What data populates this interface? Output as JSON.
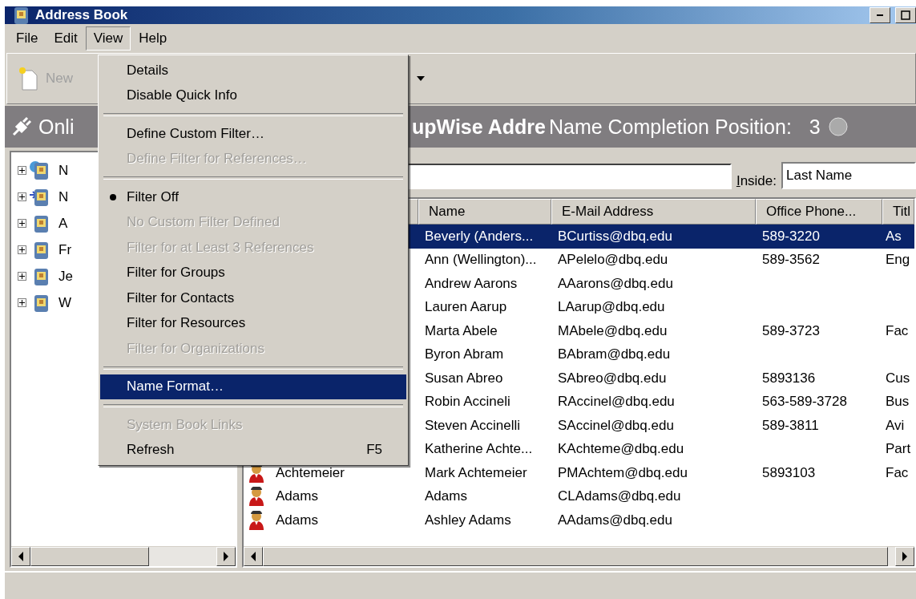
{
  "window": {
    "title": "Address Book"
  },
  "menubar": [
    {
      "label": "File",
      "selected": false
    },
    {
      "label": "Edit",
      "selected": false
    },
    {
      "label": "View",
      "selected": true
    },
    {
      "label": "Help",
      "selected": false
    }
  ],
  "toolbar": {
    "new_button": {
      "label": "New",
      "disabled": true
    }
  },
  "header": {
    "left_text": "Onli",
    "right_text": "upWise Addre",
    "position_label": "Name Completion Position:",
    "position_value": "3"
  },
  "tree": [
    {
      "label": "N",
      "kind": "globe-book",
      "expanded": false
    },
    {
      "label": "N",
      "kind": "link-book",
      "expanded": false
    },
    {
      "label": "A",
      "kind": "book",
      "expanded": false
    },
    {
      "label": "Fr",
      "kind": "book",
      "expanded": false
    },
    {
      "label": "Je",
      "kind": "book",
      "expanded": false
    },
    {
      "label": "W",
      "kind": "book",
      "expanded": false
    }
  ],
  "search": {
    "inside_label": "Inside:",
    "inside_value": "Last Name"
  },
  "table": {
    "columns": [
      "Name",
      "E-Mail Address",
      "Office Phone...",
      "Titl"
    ],
    "rows": [
      {
        "selected": true,
        "name": "Beverly (Anders...",
        "email": "BCurtiss@dbq.edu",
        "phone": "589-3220",
        "title": "As"
      },
      {
        "selected": false,
        "name": "Ann (Wellington)...",
        "email": "APelelo@dbq.edu",
        "phone": "589-3562",
        "title": "Eng"
      },
      {
        "selected": false,
        "name": "Andrew Aarons",
        "email": "AAarons@dbq.edu"
      },
      {
        "selected": false,
        "name": "Lauren Aarup",
        "email": "LAarup@dbq.edu"
      },
      {
        "selected": false,
        "name": "Marta Abele",
        "email": "MAbele@dbq.edu",
        "phone": "589-3723",
        "title": "Fac"
      },
      {
        "selected": false,
        "name": "Byron Abram",
        "email": "BAbram@dbq.edu"
      },
      {
        "selected": false,
        "name": "Susan Abreo",
        "email": "SAbreo@dbq.edu",
        "phone": "5893136",
        "title": "Cus"
      },
      {
        "selected": false,
        "name": "Robin Accineli",
        "email": "RAccinel@dbq.edu",
        "phone": "563-589-3728",
        "title": "Bus"
      },
      {
        "selected": false,
        "name": "Steven Accinelli",
        "email": "SAccinel@dbq.edu",
        "phone": "589-3811",
        "title": "Avi"
      },
      {
        "selected": false,
        "name": "Katherine Achte...",
        "email": "KAchteme@dbq.edu",
        "title": "Part"
      },
      {
        "selected": false,
        "last_name": "Achtemeier",
        "name": "Mark Achtemeier",
        "email": "PMAchtem@dbq.edu",
        "phone": "5893103",
        "title": "Fac"
      },
      {
        "selected": false,
        "last_name": "Adams",
        "name": "Adams",
        "email": "CLAdams@dbq.edu"
      },
      {
        "selected": false,
        "last_name": "Adams",
        "name": "Ashley Adams",
        "email": "AAdams@dbq.edu"
      }
    ]
  },
  "view_menu": [
    {
      "kind": "item",
      "label": "Details",
      "disabled": false,
      "checked": false,
      "selected": false
    },
    {
      "kind": "item",
      "label": "Disable Quick Info",
      "disabled": false,
      "checked": false,
      "selected": false
    },
    {
      "kind": "separator"
    },
    {
      "kind": "item",
      "label": "Define Custom Filter…",
      "disabled": false,
      "checked": false,
      "selected": false
    },
    {
      "kind": "item",
      "label": "Define Filter for References…",
      "disabled": true,
      "checked": false,
      "selected": false
    },
    {
      "kind": "separator"
    },
    {
      "kind": "item",
      "label": "Filter Off",
      "disabled": false,
      "checked": true,
      "selected": false
    },
    {
      "kind": "item",
      "label": "No Custom Filter Defined",
      "disabled": true,
      "checked": false,
      "selected": false
    },
    {
      "kind": "item",
      "label": "Filter for at Least 3 References",
      "disabled": true,
      "checked": false,
      "selected": false
    },
    {
      "kind": "item",
      "label": "Filter for Groups",
      "disabled": false,
      "checked": false,
      "selected": false
    },
    {
      "kind": "item",
      "label": "Filter for Contacts",
      "disabled": false,
      "checked": false,
      "selected": false
    },
    {
      "kind": "item",
      "label": "Filter for Resources",
      "disabled": false,
      "checked": false,
      "selected": false
    },
    {
      "kind": "item",
      "label": "Filter for Organizations",
      "disabled": true,
      "checked": false,
      "selected": false
    },
    {
      "kind": "separator"
    },
    {
      "kind": "item",
      "label": "Name Format…",
      "disabled": false,
      "checked": false,
      "selected": true
    },
    {
      "kind": "separator"
    },
    {
      "kind": "item",
      "label": "System Book Links",
      "disabled": true,
      "checked": false,
      "selected": false
    },
    {
      "kind": "item",
      "label": "Refresh",
      "shortcut": "F5",
      "disabled": false,
      "checked": false,
      "selected": false
    }
  ]
}
